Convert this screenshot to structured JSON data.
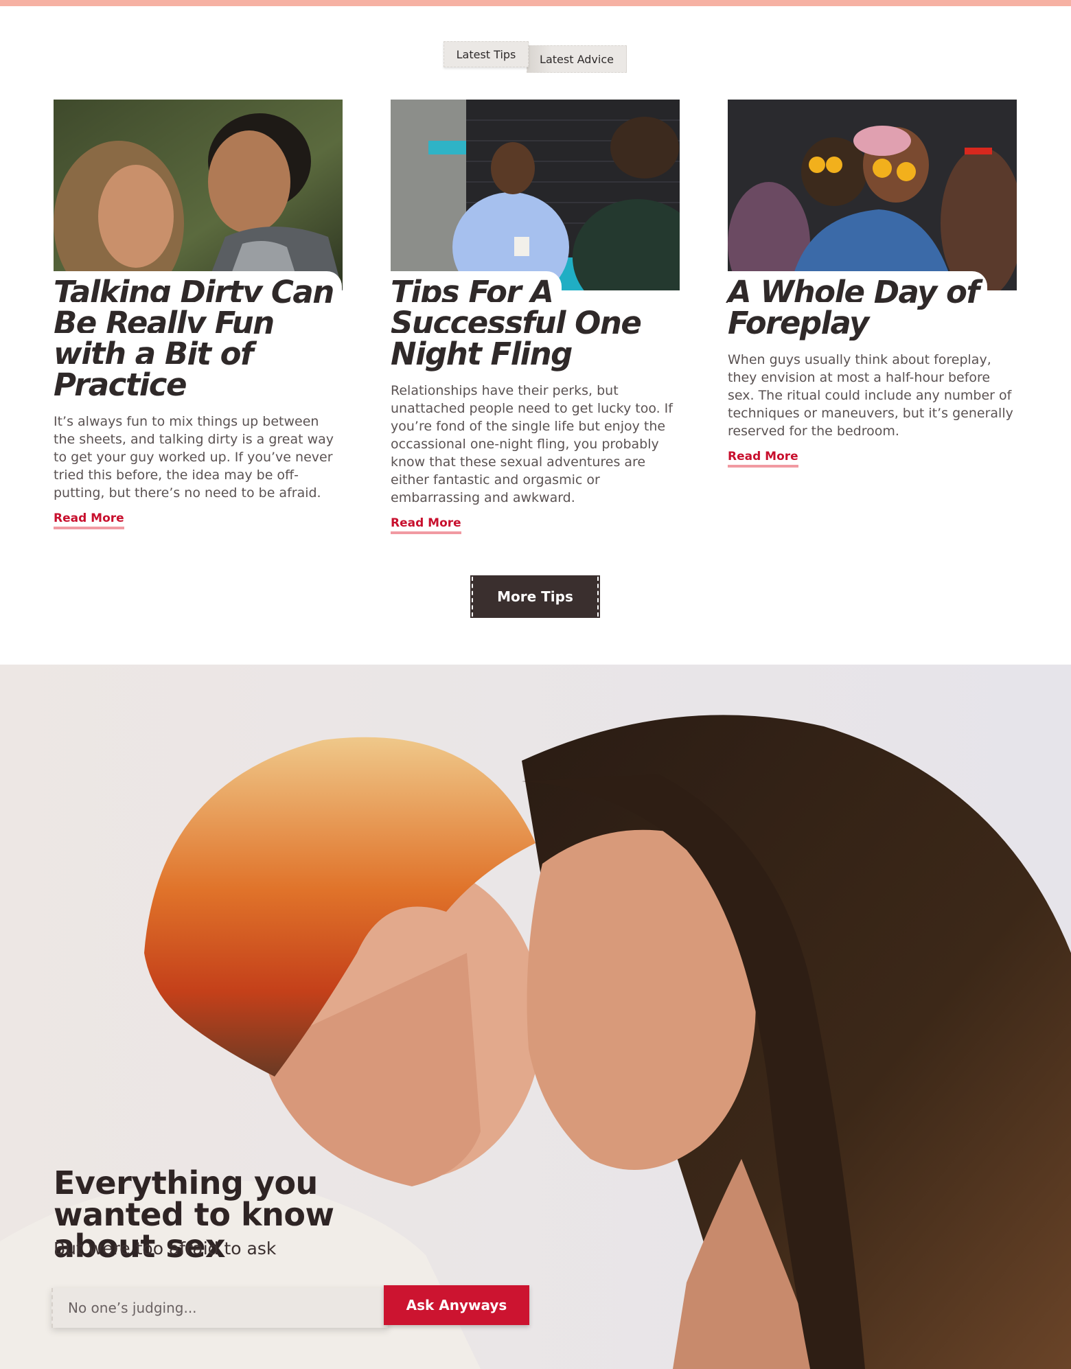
{
  "tabs": [
    {
      "label": "Latest Tips"
    },
    {
      "label": "Latest Advice"
    }
  ],
  "articles": [
    {
      "title": "Talking Dirty Can Be Really Fun with a Bit of Practice",
      "body": "It’s always fun to mix things up between the sheets, and talking dirty is a great way to get your guy worked up. If you’ve never tried this before, the idea may be off-putting, but there’s no need to be afraid.",
      "link": "Read More"
    },
    {
      "title": "Tips For A Successful One Night Fling",
      "body": "Relationships have their perks, but unattached people need to get lucky too. If you’re fond of the single life but enjoy the occassional one-night fling, you probably know that these sexual adventures are either fantastic and orgasmic or embarrassing and awkward.",
      "link": "Read More"
    },
    {
      "title": "A Whole Day of Foreplay",
      "body": "When guys usually think about foreplay, they envision at most a half-hour before sex. The ritual could include any number of techniques or maneuvers, but it’s generally reserved for the bedroom.",
      "link": "Read More"
    }
  ],
  "more_button": "More Tips",
  "hero": {
    "title": "Everything you wanted to know about sex",
    "subtitle": "But were too afraid to ask",
    "search_placeholder": "No one’s judging...",
    "ask_button": "Ask Anyways"
  },
  "colors": {
    "top_bar": "#f6b1a3",
    "accent_red": "#cc1430",
    "dark_button": "#3a2f2e",
    "link_underline": "#f19aa2"
  }
}
